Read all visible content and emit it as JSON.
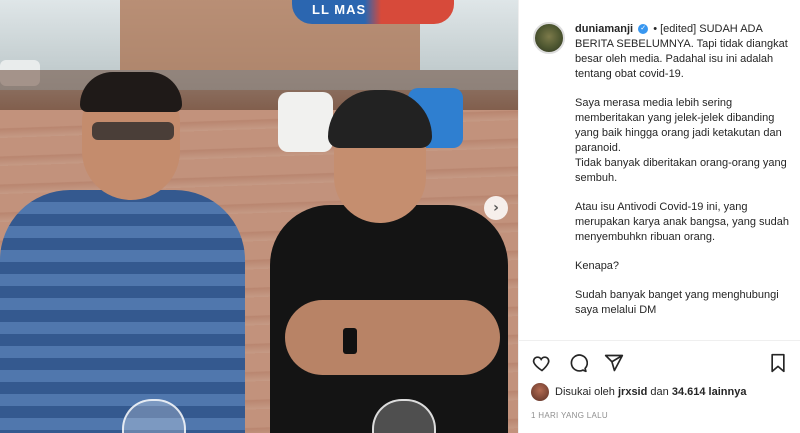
{
  "photo": {
    "umbrella_text": "LL MAS",
    "next_arrow": "›"
  },
  "caption": {
    "username": "duniamanji",
    "verified_icon": "verified-badge-icon",
    "lead": "• [edited] SUDAH ADA BERITA SEBELUMNYA. Tapi tidak diangkat besar oleh media. Padahal isu ini adalah tentang obat covid-19.",
    "para1": "Saya merasa media lebih sering memberitakan yang jelek-jelek dibanding yang baik hingga orang jadi ketakutan dan paranoid.",
    "para1b": "Tidak banyak diberitakan orang-orang yang sembuh.",
    "para2": "Atau isu Antivodi Covid-19 ini, yang merupakan karya anak bangsa, yang sudah menyembuhkn ribuan orang.",
    "para3": "Kenapa?",
    "para4": "Sudah banyak banget yang menghubungi saya melalui DM"
  },
  "actions": {
    "like_icon": "heart-icon",
    "comment_icon": "comment-icon",
    "share_icon": "send-icon",
    "save_icon": "bookmark-icon"
  },
  "likes": {
    "prefix": "Disukai oleh",
    "user": "jrxsid",
    "mid": "dan",
    "count": "34.614",
    "suffix": "lainnya"
  },
  "timestamp": "1 HARI YANG LALU",
  "colors": {
    "verified": "#3897f0",
    "text": "#262626",
    "muted": "#8e8e8e"
  }
}
